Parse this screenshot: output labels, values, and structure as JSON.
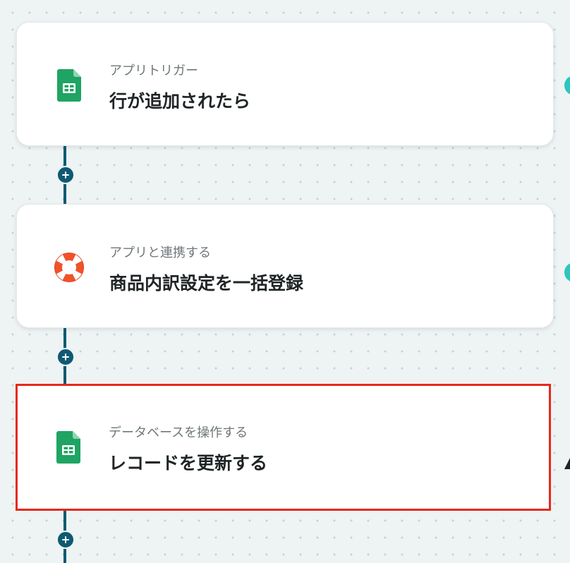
{
  "flow": {
    "steps": [
      {
        "subtitle": "アプリトリガー",
        "title": "行が追加されたら",
        "icon": "google-sheets-icon",
        "selected": false
      },
      {
        "subtitle": "アプリと連携する",
        "title": "商品内訳設定を一括登録",
        "icon": "lifebuoy-icon",
        "selected": false
      },
      {
        "subtitle": "データベースを操作する",
        "title": "レコードを更新する",
        "icon": "google-sheets-icon",
        "selected": true
      }
    ]
  },
  "colors": {
    "connector": "#0e5a72",
    "selection_border": "#e8281a",
    "sheets_green": "#1fa463",
    "lifebuoy_orange": "#f0522a",
    "status_teal": "#2cc6bd"
  }
}
